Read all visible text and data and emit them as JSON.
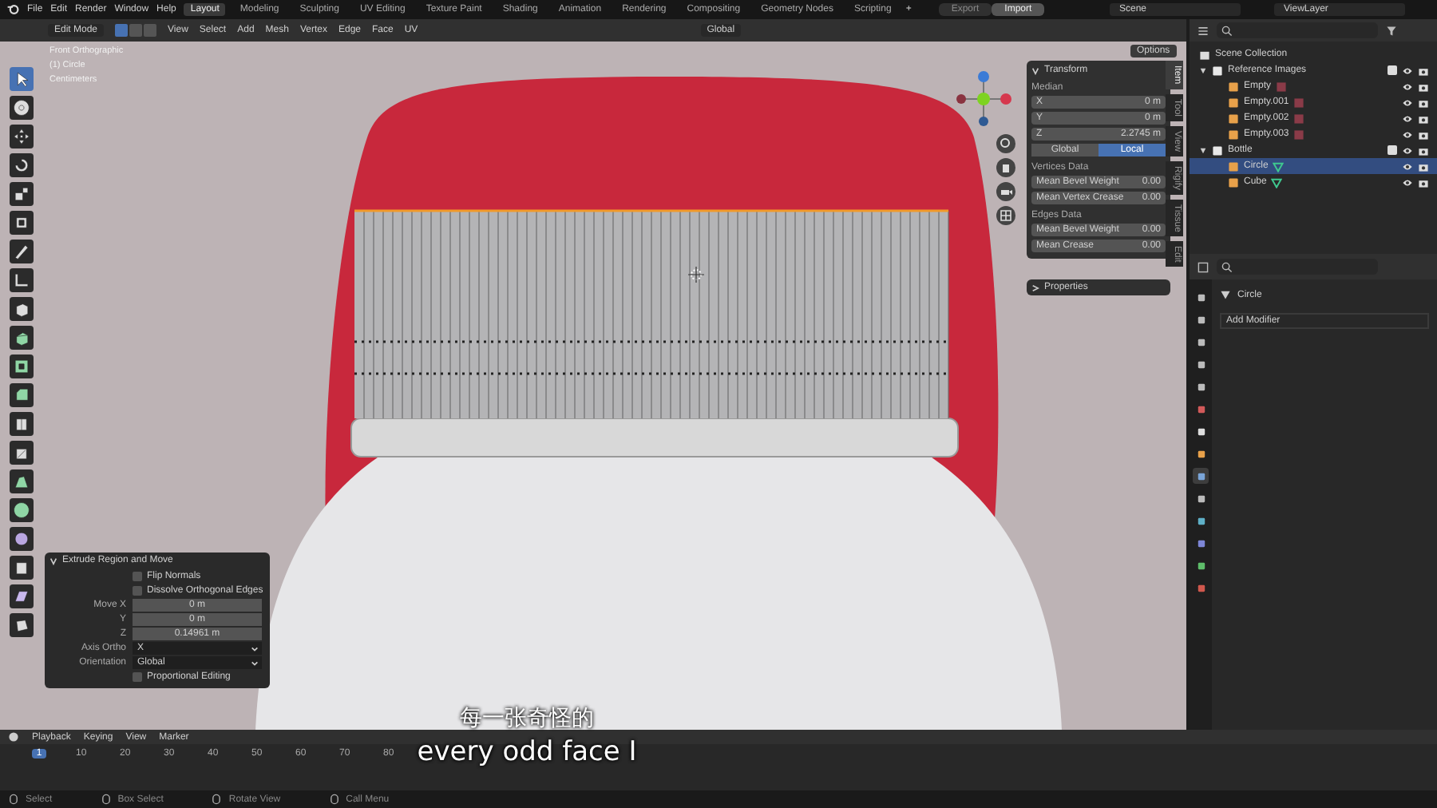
{
  "topbar": {
    "menus": [
      "File",
      "Edit",
      "Render",
      "Window",
      "Help"
    ],
    "workspaces": [
      {
        "label": "Layout",
        "selected": true
      },
      {
        "label": "Modeling",
        "selected": false
      },
      {
        "label": "Sculpting",
        "selected": false
      },
      {
        "label": "UV Editing",
        "selected": false
      },
      {
        "label": "Texture Paint",
        "selected": false
      },
      {
        "label": "Shading",
        "selected": false
      },
      {
        "label": "Animation",
        "selected": false
      },
      {
        "label": "Rendering",
        "selected": false
      },
      {
        "label": "Compositing",
        "selected": false
      },
      {
        "label": "Geometry Nodes",
        "selected": false
      },
      {
        "label": "Scripting",
        "selected": false
      }
    ],
    "add_tab": "+",
    "export": "Export",
    "import": "Import",
    "scene": "Scene",
    "view_layer": "ViewLayer"
  },
  "header": {
    "mode": "Edit Mode",
    "select_modes": [
      {
        "selected": true
      },
      {
        "selected": false
      },
      {
        "selected": false
      }
    ],
    "menus": [
      "View",
      "Select",
      "Add",
      "Mesh",
      "Vertex",
      "Edge",
      "Face",
      "UV"
    ],
    "orientation": "Global",
    "options": "Options"
  },
  "viewport": {
    "info": [
      "Front Orthographic",
      "(1) Circle",
      "Centimeters"
    ],
    "toolbar": [
      {
        "kind": "select",
        "selected": true
      },
      {
        "kind": "cursor",
        "selected": false
      },
      {
        "kind": "move",
        "selected": false
      },
      {
        "kind": "rotate",
        "selected": false
      },
      {
        "kind": "scale",
        "selected": false
      },
      {
        "kind": "transform",
        "selected": false
      },
      {
        "kind": "annotate",
        "selected": false
      },
      {
        "kind": "measure",
        "selected": false
      },
      {
        "kind": "add-cube",
        "selected": false
      },
      {
        "kind": "extrude",
        "selected": false
      },
      {
        "kind": "inset",
        "selected": false
      },
      {
        "kind": "bevel",
        "selected": false
      },
      {
        "kind": "loop-cut",
        "selected": false
      },
      {
        "kind": "knife",
        "selected": false
      },
      {
        "kind": "poly-build",
        "selected": false
      },
      {
        "kind": "spin",
        "selected": false
      },
      {
        "kind": "smooth",
        "selected": false
      },
      {
        "kind": "shrink",
        "selected": false
      },
      {
        "kind": "shear",
        "selected": false
      },
      {
        "kind": "rip",
        "selected": false
      }
    ]
  },
  "sidebar": {
    "tabs": [
      {
        "label": "Item",
        "selected": true
      },
      {
        "label": "Tool",
        "selected": false
      },
      {
        "label": "View",
        "selected": false
      },
      {
        "label": "Rigify",
        "selected": false
      },
      {
        "label": "Tissue",
        "selected": false
      },
      {
        "label": "Edit",
        "selected": false
      }
    ],
    "transform": {
      "title": "Transform",
      "expanded": true,
      "median": "Median",
      "fields": [
        {
          "label": "X",
          "value": "0 m"
        },
        {
          "label": "Y",
          "value": "0 m"
        },
        {
          "label": "Z",
          "value": "2.2745 m"
        }
      ],
      "spaces": [
        {
          "label": "Global",
          "selected": false
        },
        {
          "label": "Local",
          "selected": true
        }
      ],
      "sections": [
        {
          "title": "Vertices Data",
          "fields": [
            {
              "label": "Mean Bevel Weight",
              "value": "0.00"
            },
            {
              "label": "Mean Vertex Crease",
              "value": "0.00"
            }
          ]
        },
        {
          "title": "Edges Data",
          "fields": [
            {
              "label": "Mean Bevel Weight",
              "value": "0.00"
            },
            {
              "label": "Mean Crease",
              "value": "0.00"
            }
          ]
        }
      ]
    },
    "properties": {
      "title": "Properties",
      "expanded": false
    }
  },
  "operator": {
    "title": "Extrude Region and Move",
    "expanded": true,
    "rows": [
      {
        "kind": "checkbox",
        "label": "Flip Normals",
        "checked": false
      },
      {
        "kind": "checkbox",
        "label": "Dissolve Orthogonal Edges",
        "checked": false
      },
      {
        "kind": "number",
        "label": "Move X",
        "value": "0 m"
      },
      {
        "kind": "number",
        "label": "Y",
        "value": "0 m"
      },
      {
        "kind": "number",
        "label": "Z",
        "value": "0.14961 m"
      },
      {
        "kind": "dropdown",
        "label": "Axis Ortho",
        "value": "X"
      },
      {
        "kind": "dropdown",
        "label": "Orientation",
        "value": "Global"
      },
      {
        "kind": "checkbox",
        "label": "Proportional Editing",
        "checked": false
      }
    ]
  },
  "outliner": {
    "root": "Scene Collection",
    "items": [
      {
        "name": "Reference Images",
        "kind": "collection",
        "expanded": true,
        "checked": true,
        "selected": false,
        "children": [
          {
            "name": "Empty",
            "kind": "empty",
            "selected": false
          },
          {
            "name": "Empty.001",
            "kind": "empty",
            "selected": false
          },
          {
            "name": "Empty.002",
            "kind": "empty",
            "selected": false
          },
          {
            "name": "Empty.003",
            "kind": "empty",
            "selected": false
          }
        ]
      },
      {
        "name": "Bottle",
        "kind": "collection",
        "expanded": true,
        "checked": true,
        "selected": false,
        "children": [
          {
            "name": "Circle",
            "kind": "mesh",
            "selected": true
          },
          {
            "name": "Cube",
            "kind": "mesh",
            "selected": false
          }
        ]
      }
    ]
  },
  "properties_editor": {
    "tabs": [
      {
        "kind": "tool",
        "selected": false
      },
      {
        "kind": "render",
        "selected": false
      },
      {
        "kind": "output",
        "selected": false
      },
      {
        "kind": "view-layer",
        "selected": false
      },
      {
        "kind": "scene",
        "selected": false
      },
      {
        "kind": "world",
        "selected": false
      },
      {
        "kind": "collection",
        "selected": false
      },
      {
        "kind": "object",
        "selected": false
      },
      {
        "kind": "modifier",
        "selected": true
      },
      {
        "kind": "particles",
        "selected": false
      },
      {
        "kind": "physics",
        "selected": false
      },
      {
        "kind": "constraints",
        "selected": false
      },
      {
        "kind": "data",
        "selected": false
      },
      {
        "kind": "material",
        "selected": false
      }
    ],
    "object": "Circle",
    "add_modifier": "Add Modifier"
  },
  "timeline": {
    "menus": [
      "Playback",
      "Keying",
      "View",
      "Marker"
    ],
    "frames": [
      {
        "label": "1",
        "selected": true
      },
      {
        "label": "10",
        "selected": false
      },
      {
        "label": "20",
        "selected": false
      },
      {
        "label": "30",
        "selected": false
      },
      {
        "label": "40",
        "selected": false
      },
      {
        "label": "50",
        "selected": false
      },
      {
        "label": "60",
        "selected": false
      },
      {
        "label": "70",
        "selected": false
      },
      {
        "label": "80",
        "selected": false
      }
    ]
  },
  "status_bar": [
    "Select",
    "Box Select",
    "Rotate View",
    "Call Menu"
  ],
  "subtitles": [
    "每一张奇怪的",
    "every odd face I"
  ]
}
